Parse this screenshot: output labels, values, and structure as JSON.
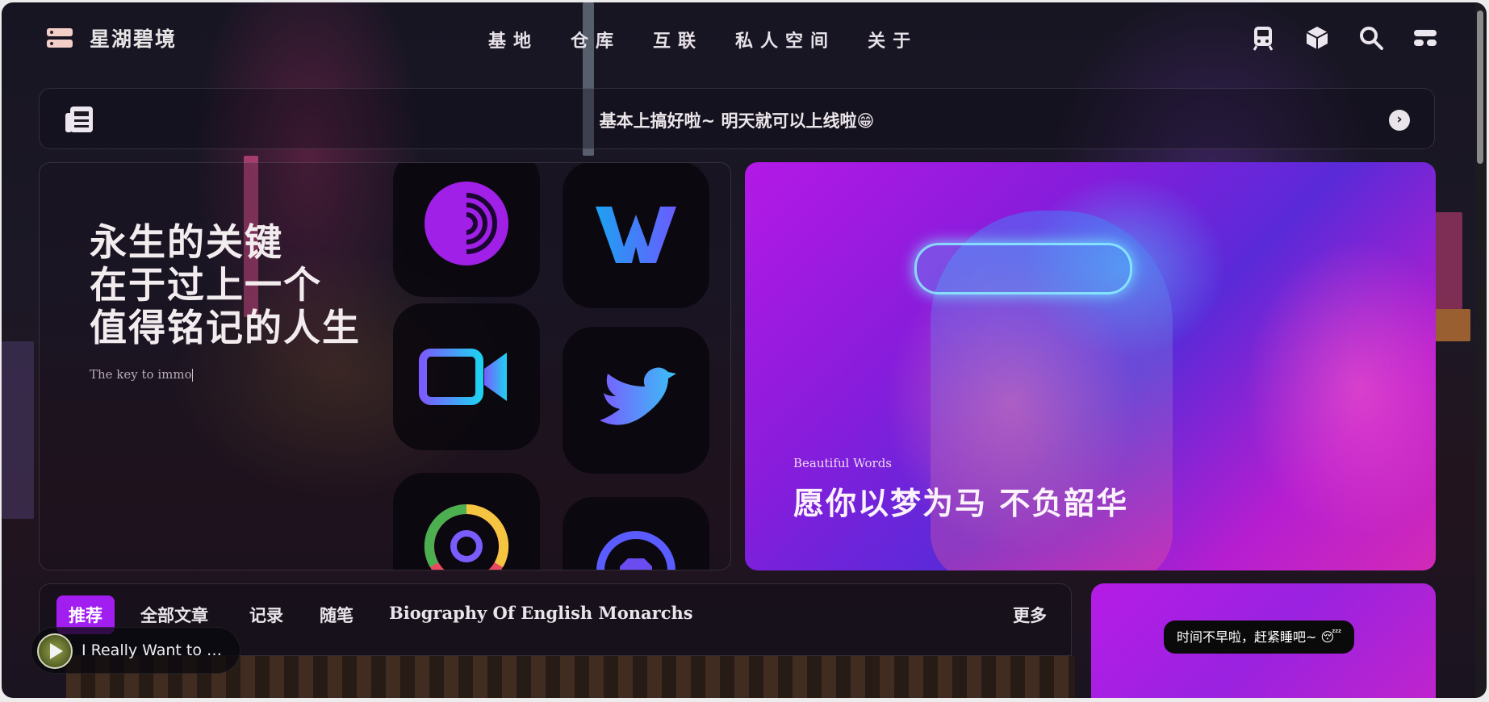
{
  "brand": {
    "title": "星湖碧境",
    "logo_icon": "server-stack-icon"
  },
  "nav": {
    "links": [
      {
        "label": "基地"
      },
      {
        "label": "仓库"
      },
      {
        "label": "互联"
      },
      {
        "label": "私人空间"
      },
      {
        "label": "关于"
      }
    ],
    "icons": [
      "train-icon",
      "cube-icon",
      "search-icon",
      "menu-toggle-icon"
    ]
  },
  "notice": {
    "icon": "newspaper-icon",
    "message": "基本上搞好啦~ 明天就可以上线啦😁",
    "arrow_icon": "chevron-right-icon"
  },
  "hero": {
    "lines": [
      "永生的关键",
      "在于过上一个",
      "值得铭记的人生"
    ],
    "subtitle": "The key to immo",
    "apps": [
      "tor-browser-icon",
      "webstorm-icon",
      "video-camera-icon",
      "twitter-bird-icon",
      "chrome-icon",
      "github-icon"
    ]
  },
  "feature": {
    "eyebrow": "Beautiful Words",
    "headline": "愿你以梦为马 不负韶华"
  },
  "tabs": {
    "items": [
      {
        "label": "推荐",
        "active": true
      },
      {
        "label": "全部文章",
        "active": false
      },
      {
        "label": "记录",
        "active": false
      },
      {
        "label": "随笔",
        "active": false
      },
      {
        "label": "Biography Of English Monarchs",
        "active": false
      }
    ],
    "more_label": "更多"
  },
  "toast": {
    "message": "时间不早啦，赶紧睡吧~ 😴"
  },
  "player": {
    "song": "I Really Want to Stay At Your House",
    "icon": "play-icon"
  },
  "colors": {
    "accent": "#a21ef0",
    "feature_gradient_start": "#b419e6",
    "feature_gradient_end": "#d22ab8"
  }
}
